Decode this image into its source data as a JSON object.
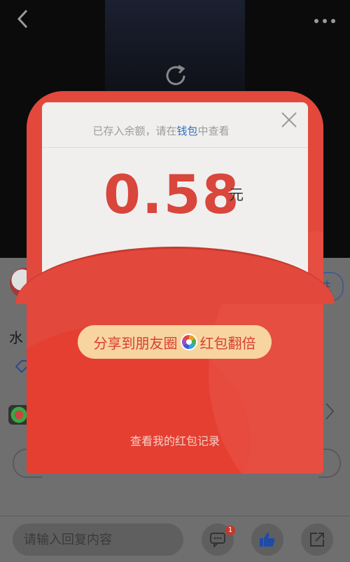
{
  "background": {
    "title_fragment": "水",
    "follow_label": "注",
    "reply_placeholder": "请输入回复内容",
    "comment_badge": "1",
    "icons": [
      "back-arrow-icon",
      "more-icon",
      "refresh-icon",
      "tag-icon",
      "chevron-right-icon",
      "comment-icon",
      "thumbs-up-icon",
      "share-icon"
    ]
  },
  "packet": {
    "notice_prefix": "已存入余额，请在",
    "notice_link": "钱包",
    "notice_suffix": "中查看",
    "amount": "0.58",
    "unit": "元",
    "share_left": "分享到朋友圈",
    "share_right": "红包翻倍",
    "record_link": "查看我的红包记录"
  },
  "colors": {
    "packet_red": "#e2483b",
    "amount_red": "#d9463b",
    "share_bg": "#f8d4a0",
    "link_blue": "#2f6fc0"
  }
}
